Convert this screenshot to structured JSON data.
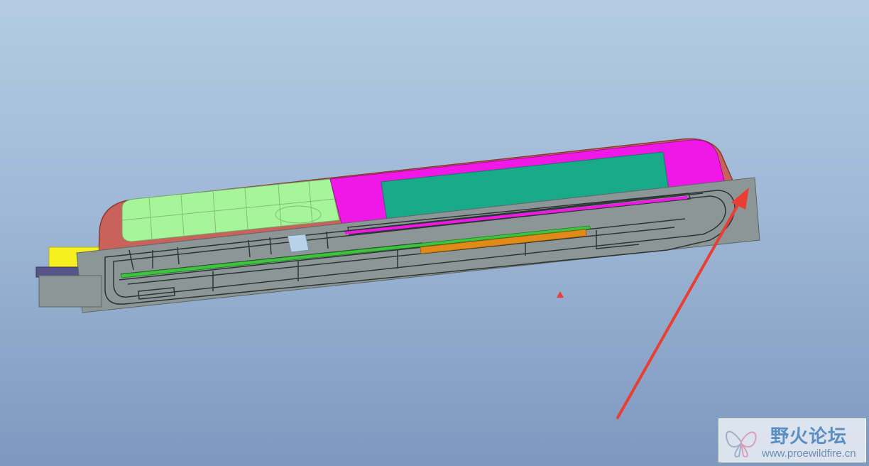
{
  "viewport": {
    "background_top": "#b4cbe3",
    "background_bottom": "#7d98bf",
    "model_subject": "phone-assembly-cross-section"
  },
  "colors": {
    "housing_shell": "#c8625a",
    "keypad": "#a6f59a",
    "display_frame": "#f018e6",
    "display_panel": "#19aa8a",
    "section_plane": "#8c9696",
    "pcb_strip": "#3ec43e",
    "battery_strip": "#e08a1a",
    "connector_yellow": "#f5f020",
    "connector_purple": "#55558a",
    "annotation_arrow": "#ea3d33"
  },
  "icons": {
    "logo": "butterfly-logo-icon",
    "arrow": "red-annotation-arrow-icon",
    "marker": "red-triangle-marker-icon"
  },
  "watermark": {
    "title": "野火论坛",
    "url": "www.proewildfire.cn"
  }
}
